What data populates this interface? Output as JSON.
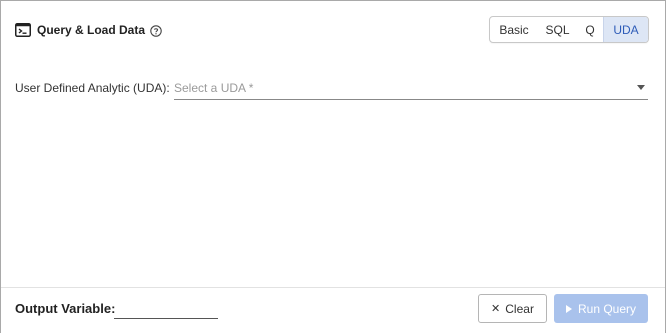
{
  "header": {
    "title": "Query & Load Data",
    "modes": [
      {
        "label": "Basic",
        "active": false
      },
      {
        "label": "SQL",
        "active": false
      },
      {
        "label": "Q",
        "active": false
      },
      {
        "label": "UDA",
        "active": true
      }
    ]
  },
  "uda": {
    "label": "User Defined Analytic (UDA):",
    "placeholder": "Select a UDA *"
  },
  "footer": {
    "output_label": "Output Variable:",
    "output_value": "",
    "clear_label": "Clear",
    "run_label": "Run Query"
  },
  "colors": {
    "active_mode_bg": "#dde6f5",
    "active_mode_text": "#2e5cb8",
    "run_button_bg": "#a9c2ec"
  },
  "icons": {
    "terminal": "terminal-icon",
    "help": "help-circle-icon",
    "dropdown": "caret-down-icon",
    "clear": "close-icon",
    "run": "play-icon"
  }
}
